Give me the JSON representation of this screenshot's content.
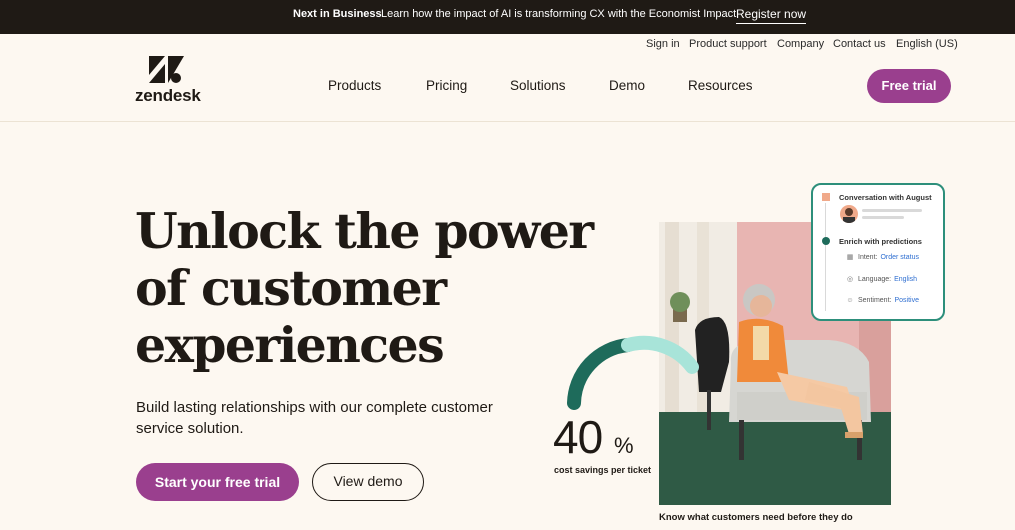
{
  "announcement": {
    "label": "Next in Business",
    "text": "Learn how the impact of AI is transforming CX with the Economist Impact",
    "link": "Register now"
  },
  "utility_nav": [
    "Sign in",
    "Product support",
    "Company",
    "Contact us",
    "English (US)"
  ],
  "brand": {
    "wordmark": "zendesk"
  },
  "main_nav": [
    "Products",
    "Pricing",
    "Solutions",
    "Demo",
    "Resources"
  ],
  "header_cta": "Free trial",
  "hero": {
    "title_lines": [
      "Unlock the power",
      "of customer",
      "experiences"
    ],
    "subtitle": "Build lasting relationships with our complete customer service solution.",
    "primary_cta": "Start your free trial",
    "secondary_cta": "View demo"
  },
  "stat": {
    "value": "40",
    "unit": "%",
    "label": "cost savings per ticket"
  },
  "photo_caption": "Know what customers need before they do",
  "prediction_card": {
    "title": "Conversation with August",
    "section": "Enrich with predictions",
    "rows": [
      {
        "icon": "grid-icon",
        "label": "Intent:",
        "value": "Order status"
      },
      {
        "icon": "globe-icon",
        "label": "Language:",
        "value": "English"
      },
      {
        "icon": "smiley-icon",
        "label": "Sentiment:",
        "value": "Positive"
      }
    ]
  },
  "colors": {
    "brand_purple": "#9a3f8e",
    "topbar_bg": "#1f1a15",
    "page_bg": "#fdf8f1",
    "accent_teal": "#2d8f7b",
    "link_blue": "#2f6fd1"
  }
}
